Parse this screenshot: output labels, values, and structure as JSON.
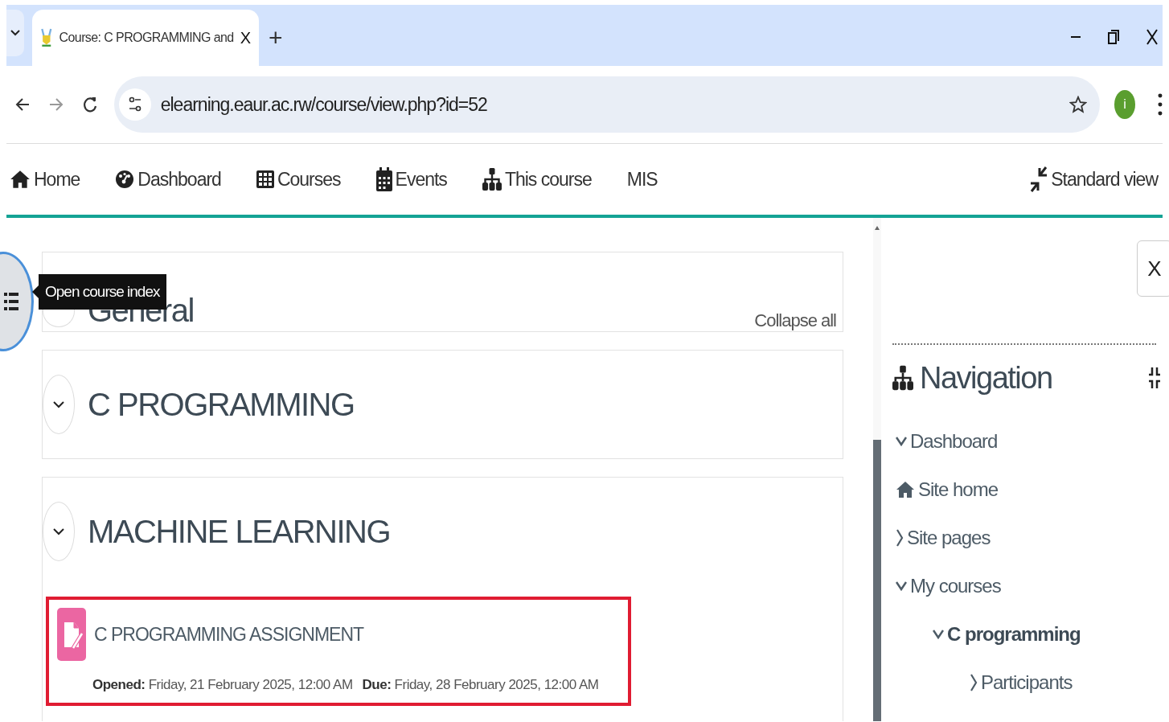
{
  "browser": {
    "tab": {
      "title": "Course: C PROGRAMMING and",
      "selected": true
    },
    "close_glyph": "X",
    "new_tab_glyph": "+",
    "url": "elearning.eaur.ac.rw/course/view.php?id=52",
    "profile_initial": "i"
  },
  "navbar": {
    "items": [
      {
        "label": "Home",
        "kind": "home"
      },
      {
        "label": "Dashboard",
        "kind": "dashboard"
      },
      {
        "label": "Courses",
        "kind": "courses"
      },
      {
        "label": "Events",
        "kind": "events"
      },
      {
        "label": "This course",
        "kind": "sitemap"
      },
      {
        "label": "MIS",
        "kind": "plain"
      }
    ],
    "view_toggle": "Standard view"
  },
  "course_index_tooltip": "Open course index",
  "collapse_all": "Collapse all",
  "sections": [
    {
      "title": "General"
    },
    {
      "title": "C PROGRAMMING",
      "expanded": true
    },
    {
      "title": "MACHINE LEARNING",
      "expanded": true,
      "activities": [
        {
          "title": "C PROGRAMMING ASSIGNMENT",
          "kind": "assignment",
          "highlighted": true,
          "dates": [
            "**Opened:** Friday, 21 February 2025, 12:00 AM",
            "**Due:** Friday, 28 February 2025, 12:00 AM"
          ]
        }
      ]
    }
  ],
  "drawer": {
    "close": "X",
    "block_title": "Navigation",
    "items": [
      {
        "label": "Dashboard",
        "kind": "node",
        "expanded": true,
        "current": false
      },
      {
        "label": "Site home",
        "kind": "home",
        "current": false
      },
      {
        "label": "Site pages",
        "kind": "node",
        "expanded": false,
        "current": false
      },
      {
        "label": "My courses",
        "kind": "node",
        "expanded": true,
        "current": false,
        "children": [
          {
            "label": "C programming",
            "kind": "node",
            "expanded": true,
            "current": true,
            "children": [
              {
                "label": "Participants",
                "kind": "node",
                "expanded": false,
                "current": false
              }
            ]
          }
        ]
      }
    ]
  }
}
